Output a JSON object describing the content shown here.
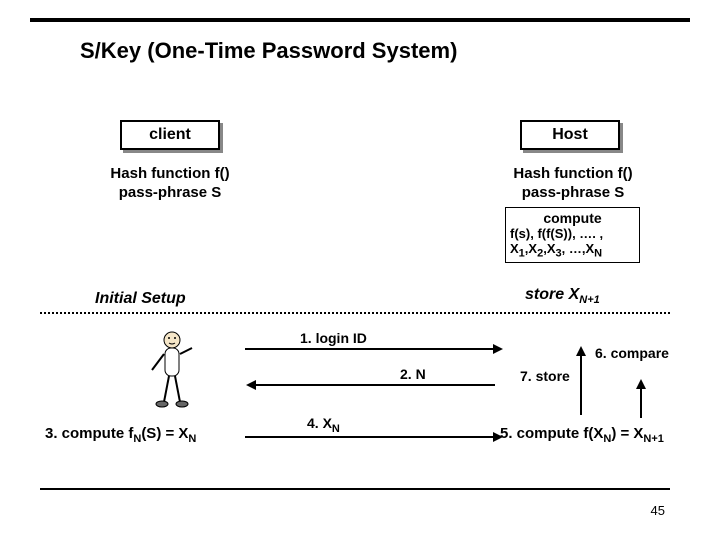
{
  "title": "S/Key (One-Time Password System)",
  "client_box": "client",
  "host_box": "Host",
  "client_hash_l1": "Hash function f()",
  "client_hash_l2": "pass-phrase S",
  "host_hash_l1": "Hash function f()",
  "host_hash_l2": "pass-phrase S",
  "compute_l1": "compute",
  "compute_l2": "f(s), f(f(S)), …. ,",
  "compute_l3_html": "X<sub>1</sub>,X<sub>2</sub>,X<sub>3</sub>, …,X<sub>N</sub>",
  "initial_setup": "Initial Setup",
  "store_html": "store X<sub>N+1</sub>",
  "step1": "1. login ID",
  "step2": "2.  N",
  "step4_html": "4. X<sub>N</sub>",
  "step6": "6. compare",
  "step7": "7. store",
  "step3_html": "3. compute f<sub>N</sub>(S) = X<sub>N</sub>",
  "step5_html": "5. compute f(X<sub>N</sub>) = X<sub>N+1</sub>",
  "page": "45"
}
